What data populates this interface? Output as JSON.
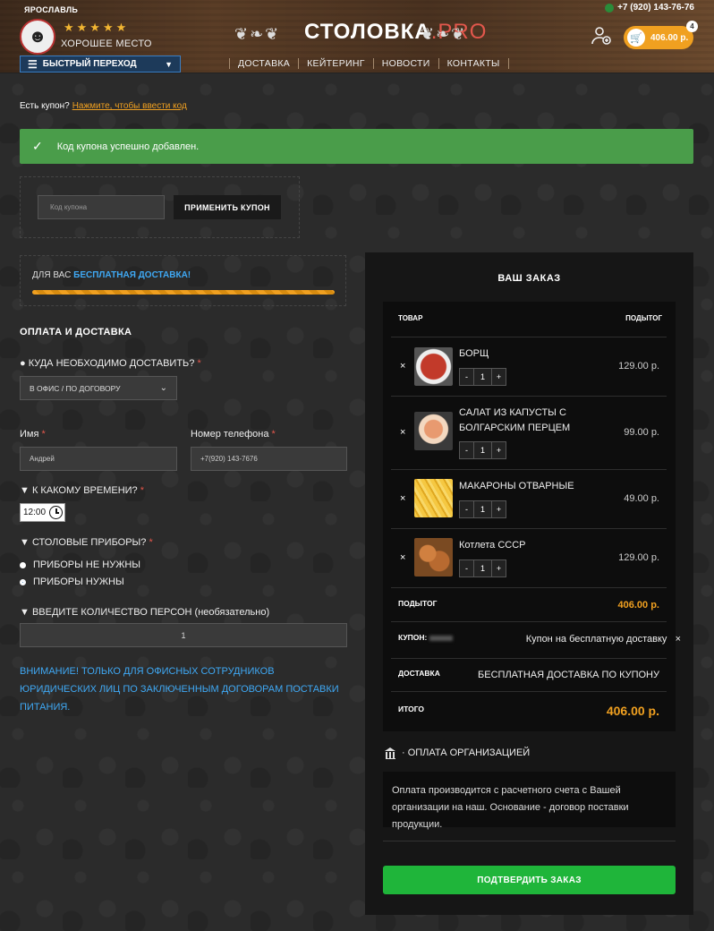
{
  "header": {
    "city": "ЯРОСЛАВЛЬ",
    "phone": "+7 (920) 143-76-76",
    "stars": "★★★★★",
    "place": "ХОРОШЕЕ МЕСТО",
    "quick_nav": "БЫСТРЫЙ ПЕРЕХОД",
    "brand_main": "СТОЛОВКА",
    "brand_suffix": ".PRO",
    "ornament_left": "❦❧❦",
    "ornament_right": "❦❧❦",
    "nav": [
      "ДОСТАВКА",
      "КЕЙТЕРИНГ",
      "НОВОСТИ",
      "КОНТАКТЫ"
    ],
    "cart_total": "406.00 р.",
    "cart_count": "4"
  },
  "coupon": {
    "question": "Есть купон?",
    "link": "Нажмите, чтобы ввести код",
    "success": "Код купона успешно добавлен.",
    "placeholder": "Код купона",
    "apply": "ПРИМЕНИТЬ КУПОН"
  },
  "free_delivery": {
    "prefix": "ДЛЯ ВАС",
    "highlight": "БЕСПЛАТНАЯ ДОСТАВКА!",
    "progress": 1.0
  },
  "form": {
    "section_title": "ОПЛАТА И ДОСТАВКА",
    "where_label": "● КУДА НЕОБХОДИМО ДОСТАВИТЬ?",
    "where_value": "В ОФИС / ПО ДОГОВОРУ",
    "name_label": "Имя",
    "name_value": "Андрей",
    "phone_label": "Номер телефона",
    "phone_value": "+7(920) 143-7676",
    "time_label": "▼ К КАКОМУ ВРЕМЕНИ?",
    "time_value": "12:00",
    "cutlery_label": "▼ СТОЛОВЫЕ ПРИБОРЫ?",
    "cutlery_options": [
      "ПРИБОРЫ НЕ НУЖНЫ",
      "ПРИБОРЫ НУЖНЫ"
    ],
    "cutlery_selected": 1,
    "persons_label": "▼ ВВЕДИТЕ КОЛИЧЕСТВО ПЕРСОН (необязательно)",
    "persons_value": "1",
    "notice": "ВНИМАНИЕ! ТОЛЬКО ДЛЯ ОФИСНЫХ СОТРУДНИКОВ ЮРИДИЧЕСКИХ ЛИЦ ПО ЗАКЛЮЧЕННЫМ ДОГОВОРАМ ПОСТАВКИ ПИТАНИЯ.",
    "required_mark": "*"
  },
  "order": {
    "title": "ВАШ ЗАКАЗ",
    "col_product": "ТОВАР",
    "col_subtotal": "ПОДЫТОГ",
    "items": [
      {
        "name": "БОРЩ",
        "qty": "1",
        "price": "129.00 р.",
        "color": "#c23a2a"
      },
      {
        "name": "САЛАТ ИЗ КАПУСТЫ С БОЛГАРСКИМ ПЕРЦЕМ",
        "qty": "1",
        "price": "99.00 р.",
        "color": "#d9a078"
      },
      {
        "name": "МАКАРОНЫ ОТВАРНЫЕ",
        "qty": "1",
        "price": "49.00 р.",
        "color": "#f0c040"
      },
      {
        "name": "Котлета СССР",
        "qty": "1",
        "price": "129.00 р.",
        "color": "#b86a30"
      }
    ],
    "minus": "-",
    "plus": "+",
    "remove": "×",
    "subtotal_label": "ПОДЫТОГ",
    "subtotal_value": "406.00 р.",
    "coupon_label": "КУПОН:",
    "coupon_value": "Купон на бесплатную доставку",
    "delivery_label": "ДОСТАВКА",
    "delivery_value": "БЕСПЛАТНАЯ ДОСТАВКА ПО КУПОНУ",
    "total_label": "ИТОГО",
    "total_value": "406.00 р.",
    "payment_title": "· ОПЛАТА ОРГАНИЗАЦИЕЙ",
    "payment_desc": "Оплата производится с расчетного счета с Вашей организации на наш. Основание - договор поставки продукции.",
    "confirm": "ПОДТВЕРДИТЬ ЗАКАЗ"
  }
}
